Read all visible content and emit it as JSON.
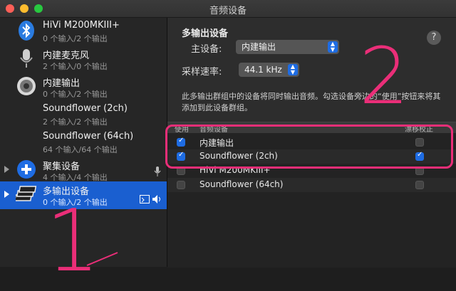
{
  "window": {
    "title": "音频设备"
  },
  "sidebar": {
    "devices": [
      {
        "name": "HiVi M200MKIII+",
        "sub": "0 个输入/2 个输出",
        "icon": "bluetooth-icon"
      },
      {
        "name": "内建麦克风",
        "sub": "2 个输入/0 个输出",
        "icon": "microphone-icon"
      },
      {
        "name": "内建输出",
        "sub": "0 个输入/2 个输出",
        "icon": "speaker-icon"
      },
      {
        "name": "Soundflower (2ch)",
        "sub": "2 个输入/2 个输出",
        "icon": ""
      },
      {
        "name": "Soundflower (64ch)",
        "sub": "64 个输入/64 个输出",
        "icon": ""
      },
      {
        "name": "聚集设备",
        "sub": "4 个输入/4 个输出",
        "icon": "plus-circle-icon"
      },
      {
        "name": "多输出设备",
        "sub": "0 个输入/2 个输出",
        "icon": "multi-output-icon"
      }
    ]
  },
  "main": {
    "heading": "多输出设备",
    "help": "?",
    "master_label": "主设备:",
    "master_value": "内建输出",
    "rate_label": "采样速率:",
    "rate_value": "44.1 kHz",
    "description": "此多输出群组中的设备将同时输出音频。勾选设备旁边的“使用”按钮来将其添加到此设备群组。",
    "table": {
      "headers": {
        "use": "使用",
        "device": "音频设备",
        "drift": "漂移校正"
      },
      "rows": [
        {
          "device": "内建输出",
          "use": true,
          "drift": false
        },
        {
          "device": "Soundflower (2ch)",
          "use": true,
          "drift": true
        },
        {
          "device": "HiVi M200MKIII+",
          "use": false,
          "drift": false
        },
        {
          "device": "Soundflower (64ch)",
          "use": false,
          "drift": false
        }
      ]
    }
  },
  "annotations": {
    "one": "1",
    "two": "2"
  },
  "colors": {
    "accent": "#1e6ce3",
    "annotation": "#ea2e78",
    "selection": "#1a5fd0"
  }
}
